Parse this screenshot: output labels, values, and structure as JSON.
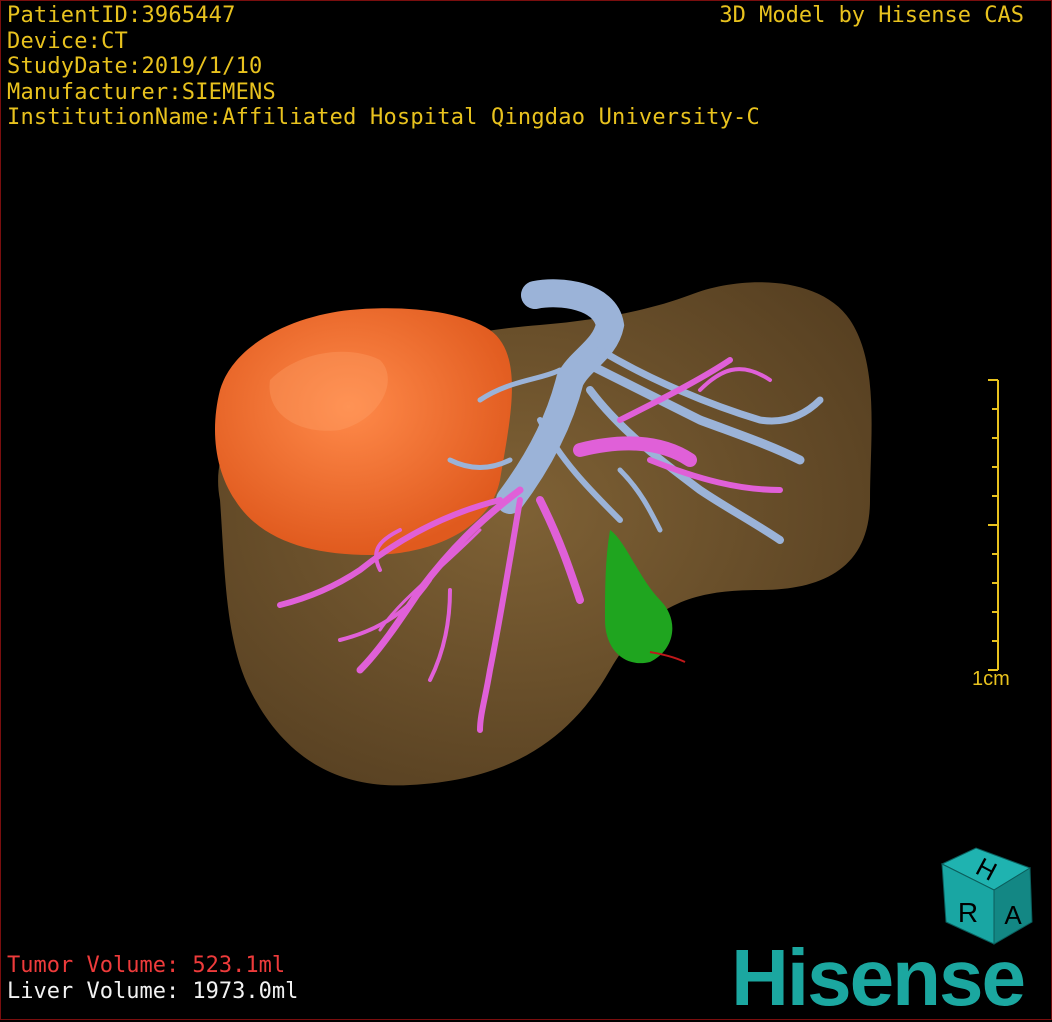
{
  "header": {
    "patient_id": "PatientID:3965447",
    "device": "Device:CT",
    "study_date": "StudyDate:2019/1/10",
    "manufacturer": "Manufacturer:SIEMENS",
    "institution": "InstitutionName:Affiliated Hospital Qingdao University-C",
    "credit": "3D Model by Hisense CAS"
  },
  "volumes": {
    "tumor": "Tumor Volume:  523.1ml",
    "liver": "Liver Volume: 1973.0ml"
  },
  "scale": {
    "label": "1cm"
  },
  "orientation_cube": {
    "top": "H",
    "front": "R",
    "side": "A"
  },
  "brand": {
    "logo": "Hisense"
  },
  "colors": {
    "info_text": "#e8c21e",
    "tumor_text": "#ee3b3b",
    "liver": "#7a5a2e",
    "tumor": "#f06a2a",
    "hepatic_vein": "#9bb3d8",
    "portal_vein": "#e060d8",
    "gallbladder": "#1fa51f",
    "logo": "#1ba7a0"
  }
}
